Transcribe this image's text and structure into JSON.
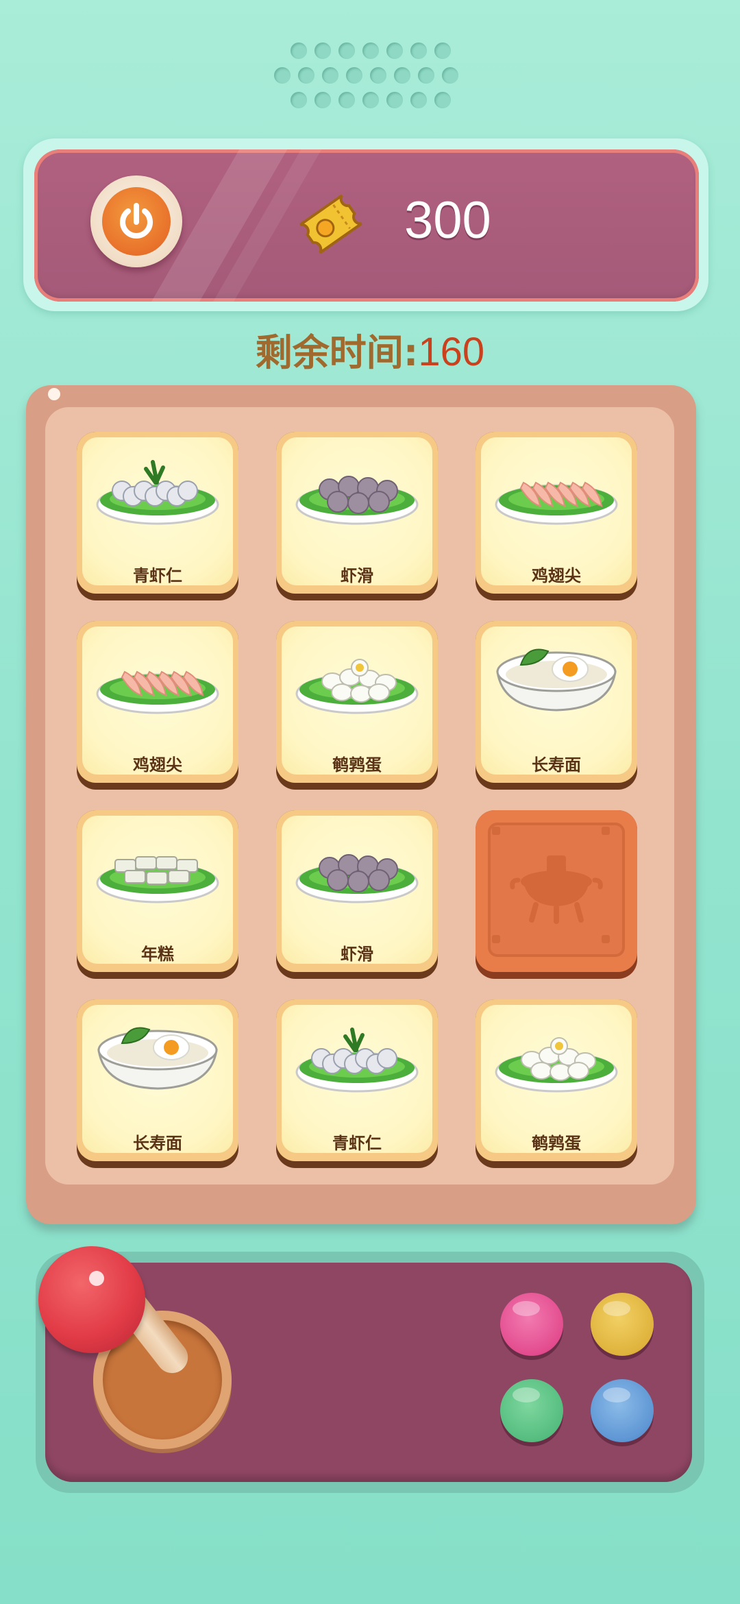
{
  "hud": {
    "score": "300",
    "timer_label": "剩余时间",
    "timer_value": "160"
  },
  "board": {
    "cards": [
      {
        "label": "青虾仁",
        "food": "shrimp-icon",
        "state": "face-up"
      },
      {
        "label": "虾滑",
        "food": "shrimp-paste-balls-icon",
        "state": "face-up"
      },
      {
        "label": "鸡翅尖",
        "food": "chicken-wing-tips-icon",
        "state": "face-up"
      },
      {
        "label": "鸡翅尖",
        "food": "chicken-wing-tips-icon",
        "state": "face-up"
      },
      {
        "label": "鹌鹑蛋",
        "food": "quail-eggs-icon",
        "state": "face-up"
      },
      {
        "label": "长寿面",
        "food": "longevity-noodles-icon",
        "state": "face-up"
      },
      {
        "label": "年糕",
        "food": "rice-cake-icon",
        "state": "face-up"
      },
      {
        "label": "虾滑",
        "food": "shrimp-paste-balls-icon",
        "state": "face-up"
      },
      {
        "label": "",
        "food": "hotpot-icon",
        "state": "face-down"
      },
      {
        "label": "长寿面",
        "food": "longevity-noodles-icon",
        "state": "face-up"
      },
      {
        "label": "青虾仁",
        "food": "shrimp-icon",
        "state": "face-up"
      },
      {
        "label": "鹌鹑蛋",
        "food": "quail-eggs-icon",
        "state": "face-up"
      }
    ]
  },
  "controller": {
    "buttons": [
      "pink",
      "yellow",
      "green",
      "blue"
    ]
  },
  "colors": {
    "background": "#a9ecd8",
    "top_bar": "#a45a78",
    "card_face": "#fff6c4",
    "card_back": "#e87d4a",
    "timer_value": "#c9411d"
  }
}
